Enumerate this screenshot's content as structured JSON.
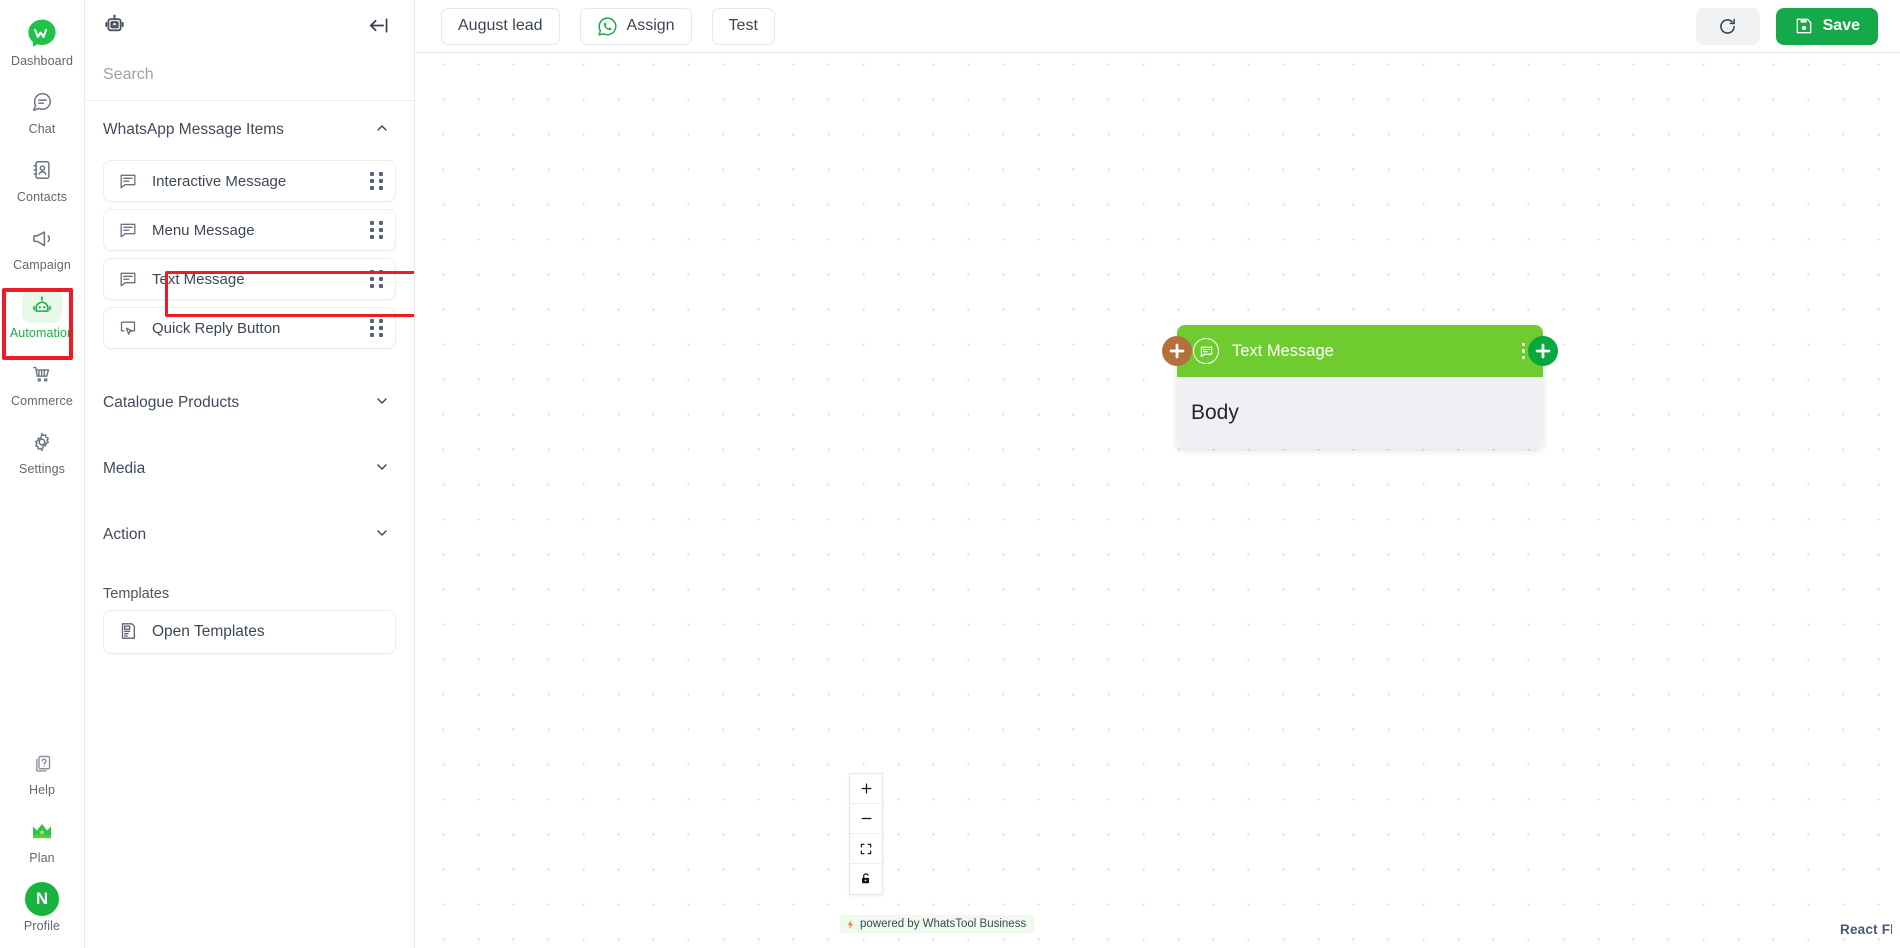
{
  "colors": {
    "brand_green": "#16a94a",
    "node_header_green": "#6fcc30",
    "accent_red": "#ed1c24",
    "handle_left": "#b4703a",
    "handle_right": "#07a83e",
    "panel_border": "#e8eaed"
  },
  "rail": {
    "logo_name": "whatstool-logo-icon",
    "items": [
      {
        "label": "Dashboard",
        "icon": "whatstool-logo-icon",
        "active": false
      },
      {
        "label": "Chat",
        "icon": "chat-bubble-icon",
        "active": false
      },
      {
        "label": "Contacts",
        "icon": "contacts-book-icon",
        "active": false
      },
      {
        "label": "Campaign",
        "icon": "megaphone-icon",
        "active": false
      },
      {
        "label": "Automation",
        "icon": "robot-icon",
        "active": true
      },
      {
        "label": "Commerce",
        "icon": "shopping-cart-icon",
        "active": false
      },
      {
        "label": "Settings",
        "icon": "gear-icon",
        "active": false
      }
    ],
    "bottom_items": [
      {
        "label": "Help",
        "icon": "help-question-icon"
      },
      {
        "label": "Plan",
        "icon": "crown-icon"
      },
      {
        "label": "Profile",
        "icon": "avatar-icon",
        "avatar_initial": "N"
      }
    ]
  },
  "panel": {
    "header_icon": "robot-icon",
    "collapse_icon": "collapse-left-arrow-icon",
    "search": {
      "value": "",
      "placeholder": "Search"
    },
    "sections": [
      {
        "title": "WhatsApp Message Items",
        "expanded": true
      },
      {
        "title": "Catalogue Products",
        "expanded": false
      },
      {
        "title": "Media",
        "expanded": false
      },
      {
        "title": "Action",
        "expanded": false
      }
    ],
    "message_items": [
      {
        "label": "Interactive Message",
        "icon": "message-lines-icon",
        "highlighted": false
      },
      {
        "label": "Menu Message",
        "icon": "message-lines-icon",
        "highlighted": false
      },
      {
        "label": "Text Message",
        "icon": "message-lines-icon",
        "highlighted": true
      },
      {
        "label": "Quick Reply Button",
        "icon": "quick-reply-cursor-icon",
        "highlighted": false
      }
    ],
    "templates_label": "Templates",
    "templates_item": {
      "label": "Open Templates",
      "icon": "template-document-icon"
    }
  },
  "topbar": {
    "tabs": [
      {
        "label": "August lead",
        "icon": null
      },
      {
        "label": "Assign",
        "icon": "whatsapp-icon"
      },
      {
        "label": "Test",
        "icon": null
      }
    ],
    "refresh_icon": "refresh-icon",
    "save_label": "Save",
    "save_icon": "floppy-disk-icon"
  },
  "canvas": {
    "node": {
      "title": "Text Message",
      "icon": "message-lines-icon",
      "menu_icon": "vertical-dots-icon",
      "body_text": "Body",
      "left_handle_icon": "plus-icon",
      "right_handle_icon": "plus-icon"
    },
    "controls": [
      {
        "name": "zoom-in",
        "icon": "plus-icon"
      },
      {
        "name": "zoom-out",
        "icon": "minus-icon"
      },
      {
        "name": "fit-view",
        "icon": "fit-view-icon"
      },
      {
        "name": "lock",
        "icon": "lock-icon"
      }
    ],
    "powered_by": "powered by WhatsTool Business",
    "powered_icon": "lightning-bolt-icon",
    "attribution": "React Fl"
  }
}
